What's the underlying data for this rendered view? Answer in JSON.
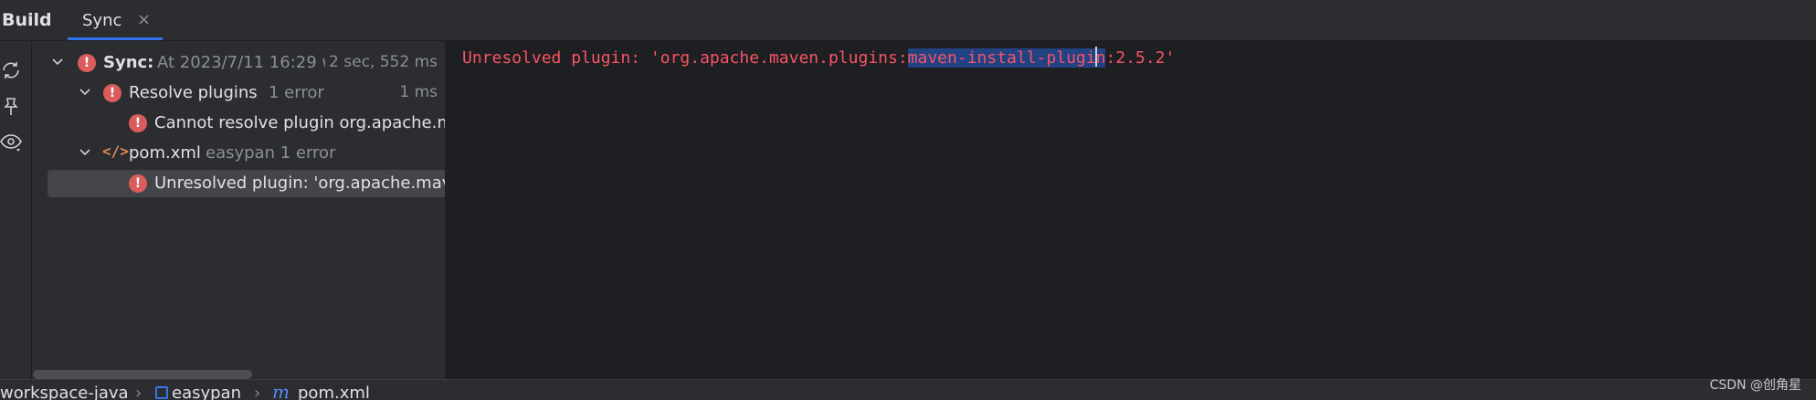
{
  "panel": {
    "title": "Build"
  },
  "tabs": [
    {
      "label": "Sync",
      "close_icon": "close-icon",
      "active": true
    }
  ],
  "toolstrip": {
    "icons": [
      "sync-icon",
      "pin-icon",
      "eye-icon"
    ]
  },
  "tree": {
    "rows": [
      {
        "label": "Sync:",
        "meta": "At 2023/7/11 16:29 w",
        "time": "2 sec, 552 ms"
      },
      {
        "label": "Resolve plugins",
        "meta": "1 error",
        "time": "1 ms"
      },
      {
        "label": "Cannot resolve plugin org.apache.m"
      },
      {
        "label": "pom.xml",
        "meta": "easypan 1 error"
      },
      {
        "label": "Unresolved plugin: 'org.apache.mav"
      }
    ]
  },
  "console": {
    "before": "Unresolved plugin: 'org.apache.maven.plugins:",
    "selected": "maven-install-plugi",
    "after_caret": "n",
    "after": ":2.5.2'"
  },
  "statusbar": {
    "crumbs": [
      "workspace-java",
      "easypan",
      "pom.xml"
    ],
    "watermark": "CSDN @创角星"
  },
  "colors": {
    "error": "#db5c5c",
    "accent": "#3574f0",
    "console_error": "#f75464",
    "selection": "#214283"
  }
}
